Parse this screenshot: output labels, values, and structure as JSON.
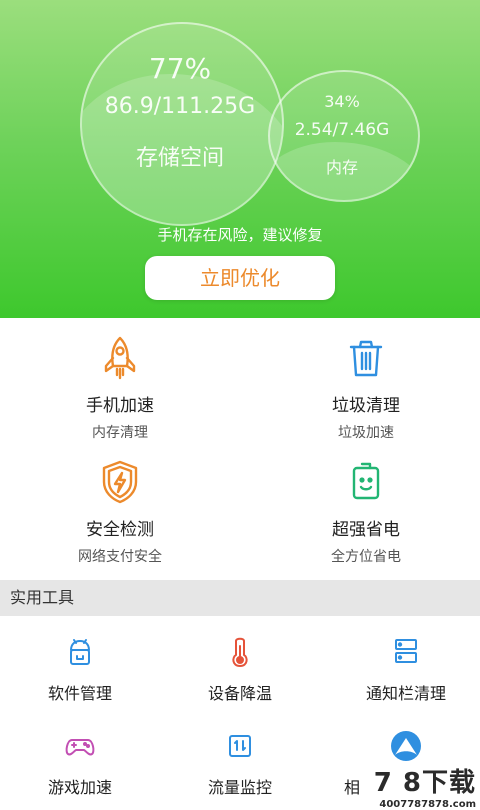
{
  "hero": {
    "storage": {
      "percent": "77%",
      "usage": "86.9/111.25G",
      "label": "存储空间"
    },
    "memory": {
      "percent": "34%",
      "usage": "2.54/7.46G",
      "label": "内存"
    },
    "risk_text": "手机存在风险，建议修复",
    "optimize_button": "立即优化"
  },
  "features": [
    {
      "title": "手机加速",
      "subtitle": "内存清理",
      "icon": "rocket-icon"
    },
    {
      "title": "垃圾清理",
      "subtitle": "垃圾加速",
      "icon": "trash-icon"
    },
    {
      "title": "安全检测",
      "subtitle": "网络支付安全",
      "icon": "shield-bolt-icon"
    },
    {
      "title": "超强省电",
      "subtitle": "全方位省电",
      "icon": "battery-icon"
    }
  ],
  "section_title": "实用工具",
  "tools": [
    {
      "label": "软件管理",
      "icon": "android-icon"
    },
    {
      "label": "设备降温",
      "icon": "thermometer-icon"
    },
    {
      "label": "通知栏清理",
      "icon": "notification-icon"
    },
    {
      "label": "游戏加速",
      "icon": "gamepad-icon"
    },
    {
      "label": "流量监控",
      "icon": "traffic-icon"
    },
    {
      "label": "相",
      "icon": "compass-icon"
    }
  ],
  "watermark": {
    "main": "7 8下载",
    "sub": "4007787878.com"
  },
  "colors": {
    "green_top": "#9bde7d",
    "green_bottom": "#3ec82d",
    "orange": "#ec8a2c",
    "blue": "#2f8fe0",
    "teal": "#22b573"
  }
}
